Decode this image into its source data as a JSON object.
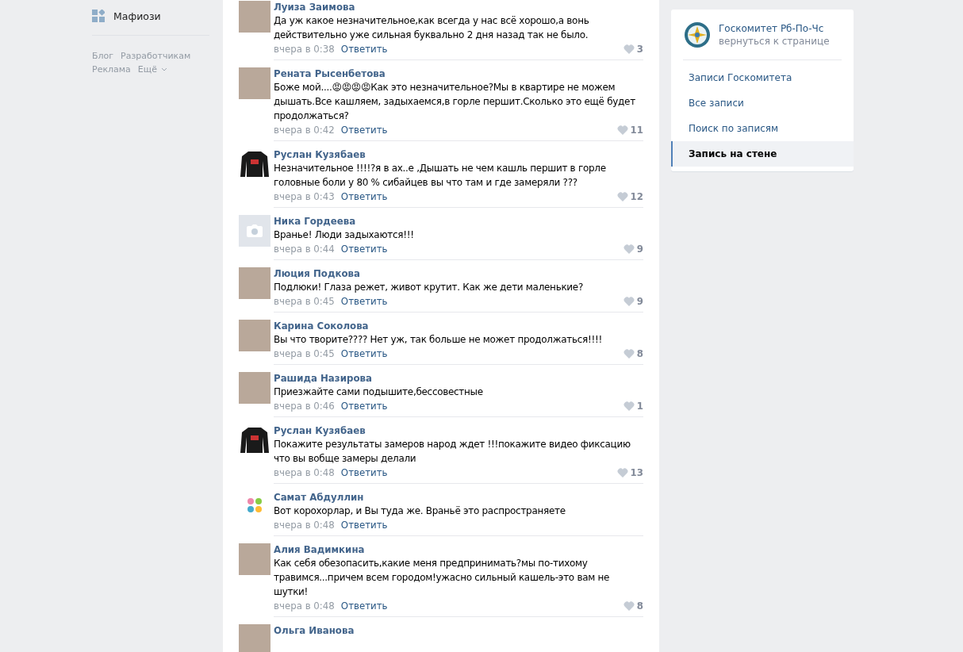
{
  "left_menu": {
    "item": {
      "label": "Мафиози"
    },
    "footer_links": [
      "Блог",
      "Разработчикам",
      "Реклама"
    ],
    "more": {
      "label": "Ещё"
    }
  },
  "comments": [
    {
      "author": "Луиза Заимова",
      "avatar": {
        "kind": "photo"
      },
      "text": "Да уж какое незначительное,как всегда у нас всё хорошо,а вонь действительно уже сильная буквально 2 дня назад так не было.",
      "time": "вчера в 0:38",
      "reply": "Ответить",
      "likes": "3"
    },
    {
      "author": "Рената Рысенбетова",
      "avatar": {
        "kind": "photo"
      },
      "text": "Боже мой....😡😡😡😡Как это незначительное?Мы в квартире не можем дышать.Все кашляем, задыхаемся,в горле першит.Сколько это ещё будет продолжаться?",
      "time": "вчера в 0:42",
      "reply": "Ответить",
      "likes": "11"
    },
    {
      "author": "Руслан Кузябаев",
      "avatar": {
        "kind": "sweater"
      },
      "text": "Незначительное !!!!?я в ах..е ,Дышать не чем кашль першит в горле головные боли у 80 % сибайцев вы что там и где замеряли ???",
      "time": "вчера в 0:43",
      "reply": "Ответить",
      "likes": "12"
    },
    {
      "author": "Ника Гордеева",
      "avatar": {
        "kind": "camera"
      },
      "text": "Вранье! Люди задыхаются!!!",
      "time": "вчера в 0:44",
      "reply": "Ответить",
      "likes": "9"
    },
    {
      "author": "Люция Подкова",
      "avatar": {
        "kind": "photo"
      },
      "text": "Подлюки! Глаза режет, живот крутит. Как же дети маленькие?",
      "time": "вчера в 0:45",
      "reply": "Ответить",
      "likes": "9"
    },
    {
      "author": "Карина Соколова",
      "avatar": {
        "kind": "photo"
      },
      "text": "Вы что творите???? Нет уж, так больше не может продолжаться!!!!",
      "time": "вчера в 0:45",
      "reply": "Ответить",
      "likes": "8"
    },
    {
      "author": "Рашида Назирова",
      "avatar": {
        "kind": "photo"
      },
      "text": "Приезжайте сами подышите,бессовестные",
      "time": "вчера в 0:46",
      "reply": "Ответить",
      "likes": "1"
    },
    {
      "author": "Руслан Кузябаев",
      "avatar": {
        "kind": "sweater"
      },
      "text": "Покажите результаты замеров народ ждет !!!покажите видео фиксацию что вы вобще замеры делали",
      "time": "вчера в 0:48",
      "reply": "Ответить",
      "likes": "13"
    },
    {
      "author": "Самат Абдуллин",
      "avatar": {
        "kind": "logo"
      },
      "text": "Вот корохорлар, и Вы туда же. Враньё это распространяете",
      "time": "вчера в 0:48",
      "reply": "Ответить"
    },
    {
      "author": "Алия Вадимкина",
      "avatar": {
        "kind": "photo"
      },
      "text": "Как себя обезопасить,какие меня предпринимать?мы по-тихому травимся...причем всем городом!ужасно сильный кашель-это вам не шутки!",
      "time": "вчера в 0:48",
      "reply": "Ответить",
      "likes": "8"
    },
    {
      "author": "Ольга Иванова",
      "avatar": {
        "kind": "photo"
      }
    }
  ],
  "community": {
    "name": "Госкомитет Рб-По-Чс",
    "back_link": "вернуться к странице",
    "menu": [
      {
        "label": "Записи Госкомитета",
        "selected": false
      },
      {
        "label": "Все записи",
        "selected": false
      },
      {
        "label": "Поиск по записям",
        "selected": false
      },
      {
        "label": "Запись на стене",
        "selected": true
      }
    ]
  }
}
